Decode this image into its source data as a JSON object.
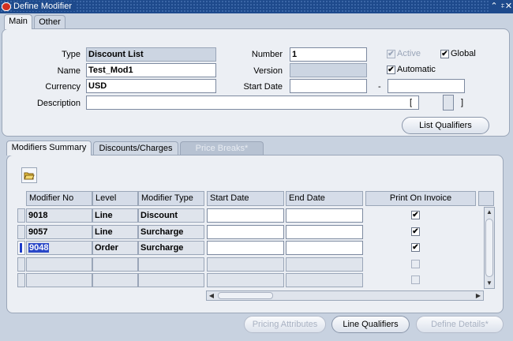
{
  "window": {
    "title": "Define Modifier",
    "controls": [
      "⌃",
      "⌗",
      "✕"
    ]
  },
  "main_tabs": [
    {
      "label": "Main"
    },
    {
      "label": "Other"
    }
  ],
  "form": {
    "type_label": "Type",
    "type_value": "Discount List",
    "name_label": "Name",
    "name_value": "Test_Mod1",
    "currency_label": "Currency",
    "currency_value": "USD",
    "description_label": "Description",
    "description_value": "",
    "number_label": "Number",
    "number_value": "1",
    "version_label": "Version",
    "version_value": "",
    "start_date_label": "Start Date",
    "start_date_value": "",
    "end_date_sep": "-",
    "end_date_value": "",
    "active_label": "Active",
    "active_checked": true,
    "global_label": "Global",
    "global_checked": true,
    "automatic_label": "Automatic",
    "automatic_checked": true,
    "bracket_open": "[",
    "bracket_close": "]"
  },
  "list_qualifiers_button": "List Qualifiers",
  "sub_tabs": [
    {
      "label": "Modifiers Summary"
    },
    {
      "label": "Discounts/Charges"
    },
    {
      "label": "Price Breaks*"
    }
  ],
  "grid": {
    "headers": [
      "Modifier No",
      "Level",
      "Modifier Type",
      "Start Date",
      "End Date",
      "Print On Invoice"
    ],
    "rows": [
      {
        "modifier_no": "9018",
        "level": "Line",
        "modifier_type": "Discount",
        "start_date": "",
        "end_date": "",
        "print": true
      },
      {
        "modifier_no": "9057",
        "level": "Line",
        "modifier_type": "Surcharge",
        "start_date": "",
        "end_date": "",
        "print": true
      },
      {
        "modifier_no": "9048",
        "level": "Order",
        "modifier_type": "Surcharge",
        "start_date": "",
        "end_date": "",
        "print": true
      },
      {
        "modifier_no": "",
        "level": "",
        "modifier_type": "",
        "start_date": "",
        "end_date": "",
        "print": false
      },
      {
        "modifier_no": "",
        "level": "",
        "modifier_type": "",
        "start_date": "",
        "end_date": "",
        "print": false
      }
    ]
  },
  "footer_buttons": {
    "pricing_attributes": "Pricing Attributes",
    "line_qualifiers": "Line Qualifiers",
    "define_details": "Define Details*"
  },
  "colors": {
    "title_bar": "#1e4a8c",
    "panel": "#eceff4",
    "background": "#c8d2e0"
  }
}
